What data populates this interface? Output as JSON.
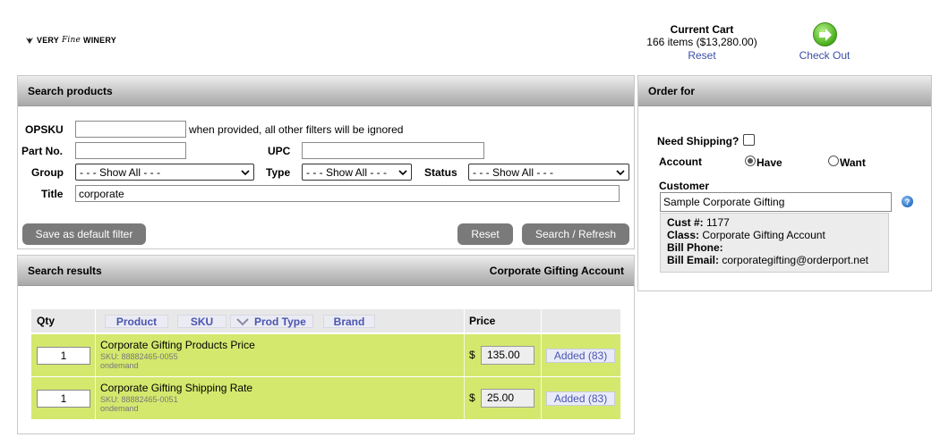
{
  "brand": {
    "logo_very": "VERY",
    "logo_fine": "Fine",
    "logo_winery": "WINERY"
  },
  "cart": {
    "title": "Current Cart",
    "summary": "166 items ($13,280.00)",
    "reset_label": "Reset",
    "checkout_label": "Check Out"
  },
  "search": {
    "title": "Search products",
    "opsku_label": "OPSKU",
    "opsku_value": "",
    "opsku_hint": "when provided, all other filters will be ignored",
    "partno_label": "Part No.",
    "partno_value": "",
    "upc_label": "UPC",
    "upc_value": "",
    "group_label": "Group",
    "group_value": "- - - Show All - - -",
    "type_label": "Type",
    "type_value": "- - - Show All - - -",
    "status_label": "Status",
    "status_value": "- - - Show All - - -",
    "title_label": "Title",
    "title_value": "corporate",
    "save_default_label": "Save as default filter",
    "reset_label": "Reset",
    "search_refresh_label": "Search / Refresh"
  },
  "results": {
    "title": "Search results",
    "account_name": "Corporate Gifting Account",
    "columns": {
      "qty": "Qty",
      "product": "Product",
      "sku": "SKU",
      "prod_type": "Prod Type",
      "brand": "Brand",
      "price": "Price"
    },
    "rows": [
      {
        "qty": "1",
        "name": "Corporate Gifting Products Price",
        "sku": "SKU: 88882465-0055",
        "type": "ondemand",
        "currency": "$",
        "price": "135.00",
        "added": "Added (83)"
      },
      {
        "qty": "1",
        "name": "Corporate Gifting Shipping Rate",
        "sku": "SKU: 88882465-0051",
        "type": "ondemand",
        "currency": "$",
        "price": "25.00",
        "added": "Added (83)"
      }
    ]
  },
  "order_for": {
    "title": "Order for",
    "need_shipping_label": "Need Shipping?",
    "account_label": "Account",
    "have_label": "Have",
    "want_label": "Want",
    "account_selected": "Have",
    "customer_label": "Customer",
    "customer_value": "Sample Corporate Gifting",
    "cust_no_label": "Cust #:",
    "cust_no_value": "1177",
    "class_label": "Class:",
    "class_value": "Corporate Gifting Account",
    "bill_phone_label": "Bill Phone:",
    "bill_phone_value": "",
    "bill_email_label": "Bill Email:",
    "bill_email_value": "corporategifting@orderport.net"
  },
  "icons": {
    "checkout": "checkout-arrow-icon",
    "help": "help-icon",
    "sort": "sort-down-icon",
    "dropdown": "chevron-down-icon"
  },
  "colors": {
    "row_bg": "#d4e86e",
    "link": "#3a4fa8",
    "button": "#7a7a7a"
  }
}
